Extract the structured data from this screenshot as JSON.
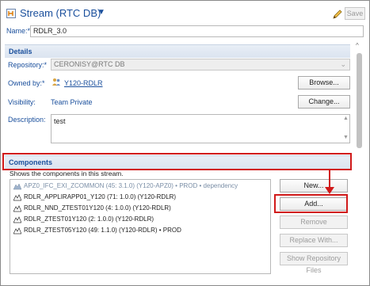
{
  "header": {
    "title": "Stream (RTC DB)",
    "caret": "▼",
    "save_label": "Save",
    "stream_icon": "stream-icon",
    "save_icon": "pencil-icon"
  },
  "name_field": {
    "label": "Name:*",
    "value": "RDLR_3.0"
  },
  "details": {
    "section_title": "Details",
    "repository_label": "Repository:*",
    "repository_value": "CERONISY@RTC DB",
    "owned_by_label": "Owned by:*",
    "owned_by_value": "Y120-RDLR",
    "browse_label": "Browse...",
    "visibility_label": "Visibility:",
    "visibility_value": "Team Private",
    "change_label": "Change...",
    "description_label": "Description:",
    "description_value": "test"
  },
  "components": {
    "section_title": "Components",
    "subtitle": "Shows the components in this stream.",
    "items": [
      {
        "label": "APZ0_IFC_EXI_ZCOMMON (45: 3.1.0) (Y120-APZ0) • PROD • dependency",
        "dim": true
      },
      {
        "label": "RDLR_APPLIRAPP01_Y120 (71: 1.0.0) (Y120-RDLR)",
        "dim": false
      },
      {
        "label": "RDLR_NND_ZTEST01Y120 (4: 1.0.0) (Y120-RDLR)",
        "dim": false
      },
      {
        "label": "RDLR_ZTEST01Y120 (2: 1.0.0) (Y120-RDLR)",
        "dim": false
      },
      {
        "label": "RDLR_ZTEST05Y120 (49: 1.1.0) (Y120-RDLR) • PROD",
        "dim": false
      }
    ],
    "new_label": "New...",
    "add_label": "Add...",
    "remove_label": "Remove",
    "replace_label": "Replace With...",
    "show_repo_label": "Show Repository Files"
  },
  "colors": {
    "accent": "#1a4f9c",
    "highlight": "#d11a1a"
  }
}
